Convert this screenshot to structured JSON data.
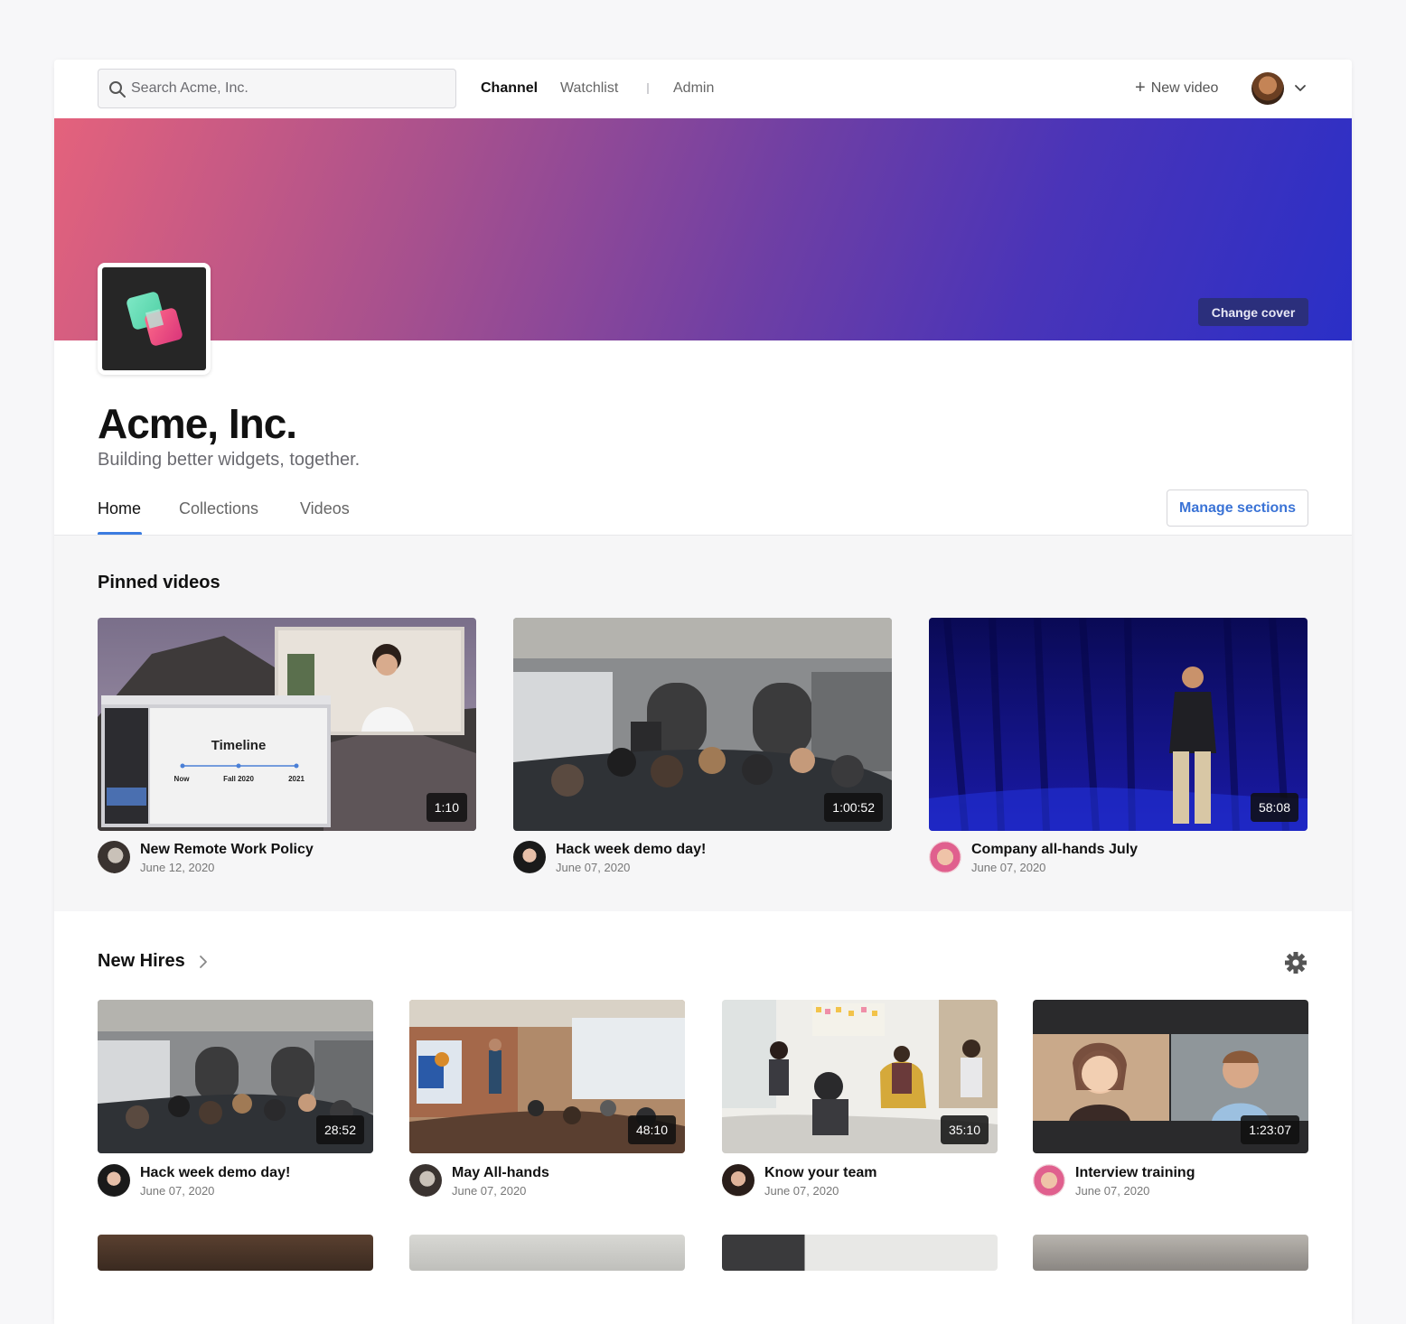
{
  "search": {
    "placeholder": "Search Acme, Inc."
  },
  "nav": {
    "channel": "Channel",
    "watchlist": "Watchlist",
    "admin": "Admin",
    "new_video": "New video"
  },
  "cover": {
    "change_cover": "Change cover"
  },
  "channel": {
    "title": "Acme, Inc.",
    "subtitle": "Building better widgets, together."
  },
  "tabs": [
    "Home",
    "Collections",
    "Videos"
  ],
  "manage_sections": "Manage sections",
  "pinned": {
    "title": "Pinned videos",
    "videos": [
      {
        "title": "New Remote Work Policy",
        "date": "June 12, 2020",
        "duration": "1:10"
      },
      {
        "title": "Hack week demo day!",
        "date": "June 07, 2020",
        "duration": "1:00:52"
      },
      {
        "title": "Company all-hands July",
        "date": "June 07, 2020",
        "duration": "58:08"
      }
    ]
  },
  "new_hires": {
    "title": "New Hires",
    "videos": [
      {
        "title": "Hack week demo day!",
        "date": "June 07, 2020",
        "duration": "28:52"
      },
      {
        "title": "May All-hands",
        "date": "June 07, 2020",
        "duration": "48:10"
      },
      {
        "title": "Know your team",
        "date": "June 07, 2020",
        "duration": "35:10"
      },
      {
        "title": "Interview training",
        "date": "June 07, 2020",
        "duration": "1:23:07"
      }
    ]
  },
  "remote_slide": {
    "title": "Timeline",
    "labels": [
      "Now",
      "Fall 2020",
      "2021"
    ]
  },
  "colors": {
    "accent": "#3b7ce0",
    "link": "#3a73d6",
    "cover_start": "#e4627c",
    "cover_end": "#2a2fc7"
  },
  "icons": {
    "search": "search-icon",
    "plus": "plus-icon",
    "chevron_down": "chevron-down-icon",
    "chevron_right": "chevron-right-icon",
    "settings": "gear-icon"
  }
}
